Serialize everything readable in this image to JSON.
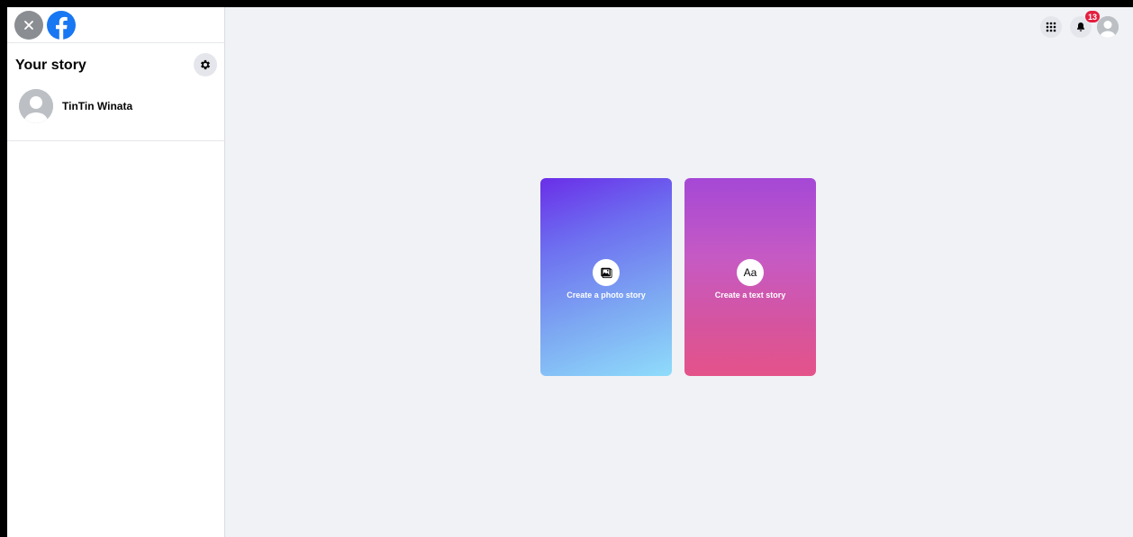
{
  "sidebar": {
    "title": "Your story",
    "user": {
      "name": "TinTin Winata"
    }
  },
  "topbar": {
    "notifications_count": "13"
  },
  "cards": {
    "photo": {
      "label": "Create a photo story"
    },
    "text": {
      "label": "Create a text story",
      "icon_text": "Aa"
    }
  },
  "colors": {
    "brand": "#1877f2",
    "badge": "#e41e3f",
    "background": "#f0f2f5"
  },
  "icons": [
    "close-icon",
    "facebook-logo",
    "gear-icon",
    "avatar-icon",
    "menu-grid-icon",
    "bell-icon",
    "photo-icon"
  ]
}
